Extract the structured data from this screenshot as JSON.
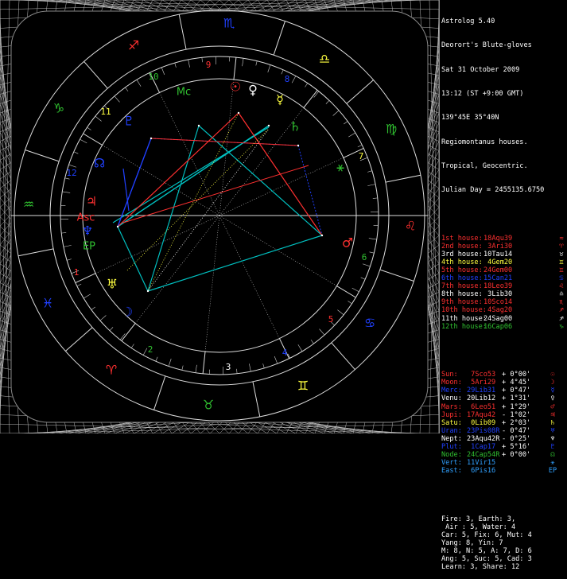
{
  "app": {
    "title": "Astrolog 5.40",
    "chart_name": "Deorort's Blute-gloves",
    "date": "Sat 31 October 2009",
    "time": "13:12 (ST +9:00 GMT)",
    "location": "139°45E 35°40N",
    "house_system": "Regiomontanus houses.",
    "zodiac": "Tropical, Geocentric.",
    "julian": "Julian Day = 2455135.6750"
  },
  "houses": [
    {
      "label": "1st house:",
      "value": "18Aqu39",
      "glyph": "≈",
      "color": "#ff3030"
    },
    {
      "label": "2nd house:",
      "value": " 3Ari30",
      "glyph": "♈",
      "color": "#ff3030"
    },
    {
      "label": "3rd house:",
      "value": "10Tau14",
      "glyph": "♉",
      "color": "#ffffff"
    },
    {
      "label": "4th house:",
      "value": " 4Gem20",
      "glyph": "♊",
      "color": "#ffff40"
    },
    {
      "label": "5th house:",
      "value": "24Gem00",
      "glyph": "♊",
      "color": "#ff3030"
    },
    {
      "label": "6th house:",
      "value": "15Can21",
      "glyph": "♋",
      "color": "#2040ff"
    },
    {
      "label": "7th house:",
      "value": "18Leo39",
      "glyph": "♌",
      "color": "#ff3030"
    },
    {
      "label": "8th house:",
      "value": " 3Lib30",
      "glyph": "♎",
      "color": "#ffffff"
    },
    {
      "label": "9th house:",
      "value": "10Sco14",
      "glyph": "♏",
      "color": "#ff3030"
    },
    {
      "label": "10th house:",
      "value": " 4Sag20",
      "glyph": "♐",
      "color": "#ff3030"
    },
    {
      "label": "11th house:",
      "value": "24Sag00",
      "glyph": "♐",
      "color": "#ffffff"
    },
    {
      "label": "12th house:",
      "value": "16Cap06",
      "glyph": "♑",
      "color": "#30c030"
    }
  ],
  "planets": [
    {
      "name": "Sun:",
      "pos": " 7Sco53",
      "lat": "+ 0°00'",
      "glyph": "☉",
      "color": "#ff3030"
    },
    {
      "name": "Moon:",
      "pos": " 5Ari29",
      "lat": "+ 4°45'",
      "glyph": "☽",
      "color": "#ff3030"
    },
    {
      "name": "Merc:",
      "pos": "29Lib31",
      "lat": "+ 0°47'",
      "glyph": "☿",
      "color": "#2040ff"
    },
    {
      "name": "Venu:",
      "pos": "20Lib12",
      "lat": "+ 1°31'",
      "glyph": "♀",
      "color": "#ffffff"
    },
    {
      "name": "Mars:",
      "pos": " 6Leo51",
      "lat": "+ 1°29'",
      "glyph": "♂",
      "color": "#ff3030"
    },
    {
      "name": "Jupi:",
      "pos": "17Aqu42",
      "lat": "- 1°02'",
      "glyph": "♃",
      "color": "#ff3030"
    },
    {
      "name": "Satu:",
      "pos": " 0Lib09",
      "lat": "+ 2°03'",
      "glyph": "♄",
      "color": "#ffff40"
    },
    {
      "name": "Uran:",
      "pos": "23Pis08R",
      "lat": "- 0°47'",
      "glyph": "♅",
      "color": "#2040ff"
    },
    {
      "name": "Nept:",
      "pos": "23Aqu42R",
      "lat": "- 0°25'",
      "glyph": "♆",
      "color": "#ffffff"
    },
    {
      "name": "Plut:",
      "pos": " 1Cap17",
      "lat": "+ 5°16'",
      "glyph": "♇",
      "color": "#2040ff"
    },
    {
      "name": "Node:",
      "pos": "24Cap54R",
      "lat": "+ 0°00'",
      "glyph": "☊",
      "color": "#30c030"
    },
    {
      "name": "Vert:",
      "pos": "11Vir15",
      "lat": "",
      "glyph": "⚹",
      "color": "#30a0ff"
    },
    {
      "name": "East:",
      "pos": " 6Pis16",
      "lat": "",
      "glyph": "EP",
      "color": "#30a0ff"
    }
  ],
  "stats": [
    "Fire: 3, Earth: 3,",
    " Air : 5, Water: 4",
    "Car: 5, Fix: 6, Mut: 4",
    "Yang: 8, Yin: 7",
    "M: 8, N: 5, A: 7, D: 6",
    "Ang: 5, Suc: 5, Cad: 3",
    "Learn: 3, Share: 12"
  ],
  "wheel": {
    "signs": [
      {
        "glyph": "♒",
        "name": "aquarius",
        "color": "#30c030"
      },
      {
        "glyph": "♑",
        "name": "capricorn",
        "color": "#30c030"
      },
      {
        "glyph": "♐",
        "name": "sagittarius",
        "color": "#ff3030"
      },
      {
        "glyph": "♏",
        "name": "scorpio",
        "color": "#2040ff"
      },
      {
        "glyph": "♎",
        "name": "libra",
        "color": "#ffff40"
      },
      {
        "glyph": "♍",
        "name": "virgo",
        "color": "#30c030"
      },
      {
        "glyph": "♌",
        "name": "leo",
        "color": "#ff3030"
      },
      {
        "glyph": "♋",
        "name": "cancer",
        "color": "#2040ff"
      },
      {
        "glyph": "♊",
        "name": "gemini",
        "color": "#ffff40"
      },
      {
        "glyph": "♉",
        "name": "taurus",
        "color": "#30c030"
      },
      {
        "glyph": "♈",
        "name": "aries",
        "color": "#ff3030"
      },
      {
        "glyph": "♓",
        "name": "pisces",
        "color": "#2040ff"
      }
    ],
    "house_numbers": [
      {
        "n": "1",
        "color": "#ff3030"
      },
      {
        "n": "2",
        "color": "#30c030"
      },
      {
        "n": "3",
        "color": "#ffffff"
      },
      {
        "n": "4",
        "color": "#2040ff"
      },
      {
        "n": "5",
        "color": "#ff3030"
      },
      {
        "n": "6",
        "color": "#30c030"
      },
      {
        "n": "7",
        "color": "#ffff40"
      },
      {
        "n": "8",
        "color": "#2040ff"
      },
      {
        "n": "9",
        "color": "#ff3030"
      },
      {
        "n": "10",
        "color": "#30c030"
      },
      {
        "n": "11",
        "color": "#ffff40"
      },
      {
        "n": "12",
        "color": "#2040ff"
      }
    ],
    "planet_glyphs": [
      {
        "g": "☉",
        "name": "sun",
        "color": "#ff3030"
      },
      {
        "g": "♀",
        "name": "venus",
        "color": "#ffffff"
      },
      {
        "g": "☿",
        "name": "mercury",
        "color": "#ffff40"
      },
      {
        "g": "♄",
        "name": "saturn",
        "color": "#30c030"
      },
      {
        "g": "⚹",
        "name": "vertex",
        "color": "#30c030"
      },
      {
        "g": "♂",
        "name": "mars",
        "color": "#ff3030"
      },
      {
        "g": "☽",
        "name": "moon",
        "color": "#2040ff"
      },
      {
        "g": "♅",
        "name": "uranus",
        "color": "#ffff40"
      },
      {
        "g": "EP",
        "name": "east-point",
        "color": "#30c030"
      },
      {
        "g": "♆",
        "name": "neptune",
        "color": "#2040ff"
      },
      {
        "g": "Asc",
        "name": "ascendant",
        "color": "#ff3030"
      },
      {
        "g": "♃",
        "name": "jupiter",
        "color": "#ff3030"
      },
      {
        "g": "☊",
        "name": "node",
        "color": "#2040ff"
      },
      {
        "g": "♇",
        "name": "pluto",
        "color": "#2040ff"
      },
      {
        "g": "Mc",
        "name": "midheaven",
        "color": "#30c030"
      }
    ]
  }
}
